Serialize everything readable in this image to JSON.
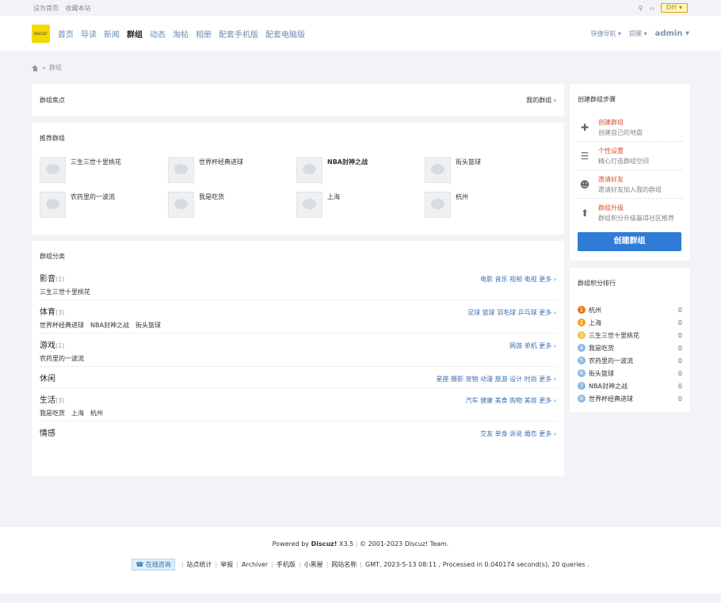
{
  "topbar": {
    "set_home": "设为首页",
    "favorite": "收藏本站",
    "diy": "DIY"
  },
  "header": {
    "logo": "DISCUZ!",
    "nav": [
      "首页",
      "导读",
      "新闻",
      "群组",
      "动态",
      "淘帖",
      "相册",
      "配套手机版",
      "配套电脑版"
    ],
    "active_index": 3,
    "quick_nav": "快捷导航",
    "remind": "提醒",
    "user": "admin"
  },
  "breadcrumb": {
    "sep": "»",
    "current": "群组"
  },
  "focus": {
    "title": "群组焦点",
    "my_groups": "我的群组 ›"
  },
  "recommend": {
    "title": "推荐群组",
    "groups": [
      "三生三世十里桃花",
      "世界杯经典进球",
      "NBA封神之战",
      "街头篮球",
      "农药里的一波流",
      "我是吃货",
      "上海",
      "杭州"
    ]
  },
  "categories": {
    "title": "群组分类",
    "items": [
      {
        "name": "影音",
        "count": "(1)",
        "tags": "电影 音乐 视频 电视 更多 ›",
        "groups": [
          "三生三世十里桃花"
        ]
      },
      {
        "name": "体育",
        "count": "(3)",
        "tags": "足球 篮球 羽毛球 乒乓球 更多 ›",
        "groups": [
          "世界杯经典进球",
          "NBA封神之战",
          "街头篮球"
        ]
      },
      {
        "name": "游戏",
        "count": "(1)",
        "tags": "网游 单机 更多 ›",
        "groups": [
          "农药里的一波流"
        ]
      },
      {
        "name": "休闲",
        "count": "",
        "tags": "星座 摄影 宠物 动漫 旅游 设计 时尚 更多 ›",
        "groups": []
      },
      {
        "name": "生活",
        "count": "(3)",
        "tags": "汽车 健康 美食 购物 美容 更多 ›",
        "groups": [
          "我是吃货",
          "上海",
          "杭州"
        ]
      },
      {
        "name": "情感",
        "count": "",
        "tags": "交友 单身 诉说 婚恋 更多 ›",
        "groups": []
      }
    ]
  },
  "steps": {
    "title": "创建群组步骤",
    "items": [
      {
        "title": "创建群组",
        "desc": "创建自己的地盘",
        "icon": "plus-icon"
      },
      {
        "title": "个性设置",
        "desc": "精心打造群组空间",
        "icon": "list-icon"
      },
      {
        "title": "邀请好友",
        "desc": "邀请好友加入我的群组",
        "icon": "user-icon"
      },
      {
        "title": "群组升级",
        "desc": "群组积分升级赢得社区推荐",
        "icon": "arrow-up-icon"
      }
    ],
    "button": "创建群组"
  },
  "rank": {
    "title": "群组积分排行",
    "items": [
      {
        "num": "1",
        "name": "杭州",
        "score": "0",
        "color": "#e8781f"
      },
      {
        "num": "2",
        "name": "上海",
        "score": "0",
        "color": "#f0a21b"
      },
      {
        "num": "3",
        "name": "三生三世十里桃花",
        "score": "0",
        "color": "#f5c23a"
      },
      {
        "num": "4",
        "name": "我是吃货",
        "score": "0",
        "color": "#8ab8e6"
      },
      {
        "num": "5",
        "name": "农药里的一波流",
        "score": "0",
        "color": "#8ab8e6"
      },
      {
        "num": "6",
        "name": "街头篮球",
        "score": "0",
        "color": "#8ab8e6"
      },
      {
        "num": "7",
        "name": "NBA封神之战",
        "score": "0",
        "color": "#8ab8e6"
      },
      {
        "num": "8",
        "name": "世界杯经典进球",
        "score": "0",
        "color": "#8ab8e6"
      }
    ]
  },
  "footer": {
    "powered": "Powered by",
    "brand": "Discuz!",
    "version": "X3.5",
    "copyright": "© 2001-2023 Discuz! Team.",
    "service": "在线咨询",
    "links": [
      "站点统计",
      "举报",
      "Archiver",
      "手机版",
      "小黑屋",
      "网站名称"
    ],
    "stats": "GMT, 2023-5-13 08:11 , Processed in 0.040174 second(s), 20 queries ."
  }
}
